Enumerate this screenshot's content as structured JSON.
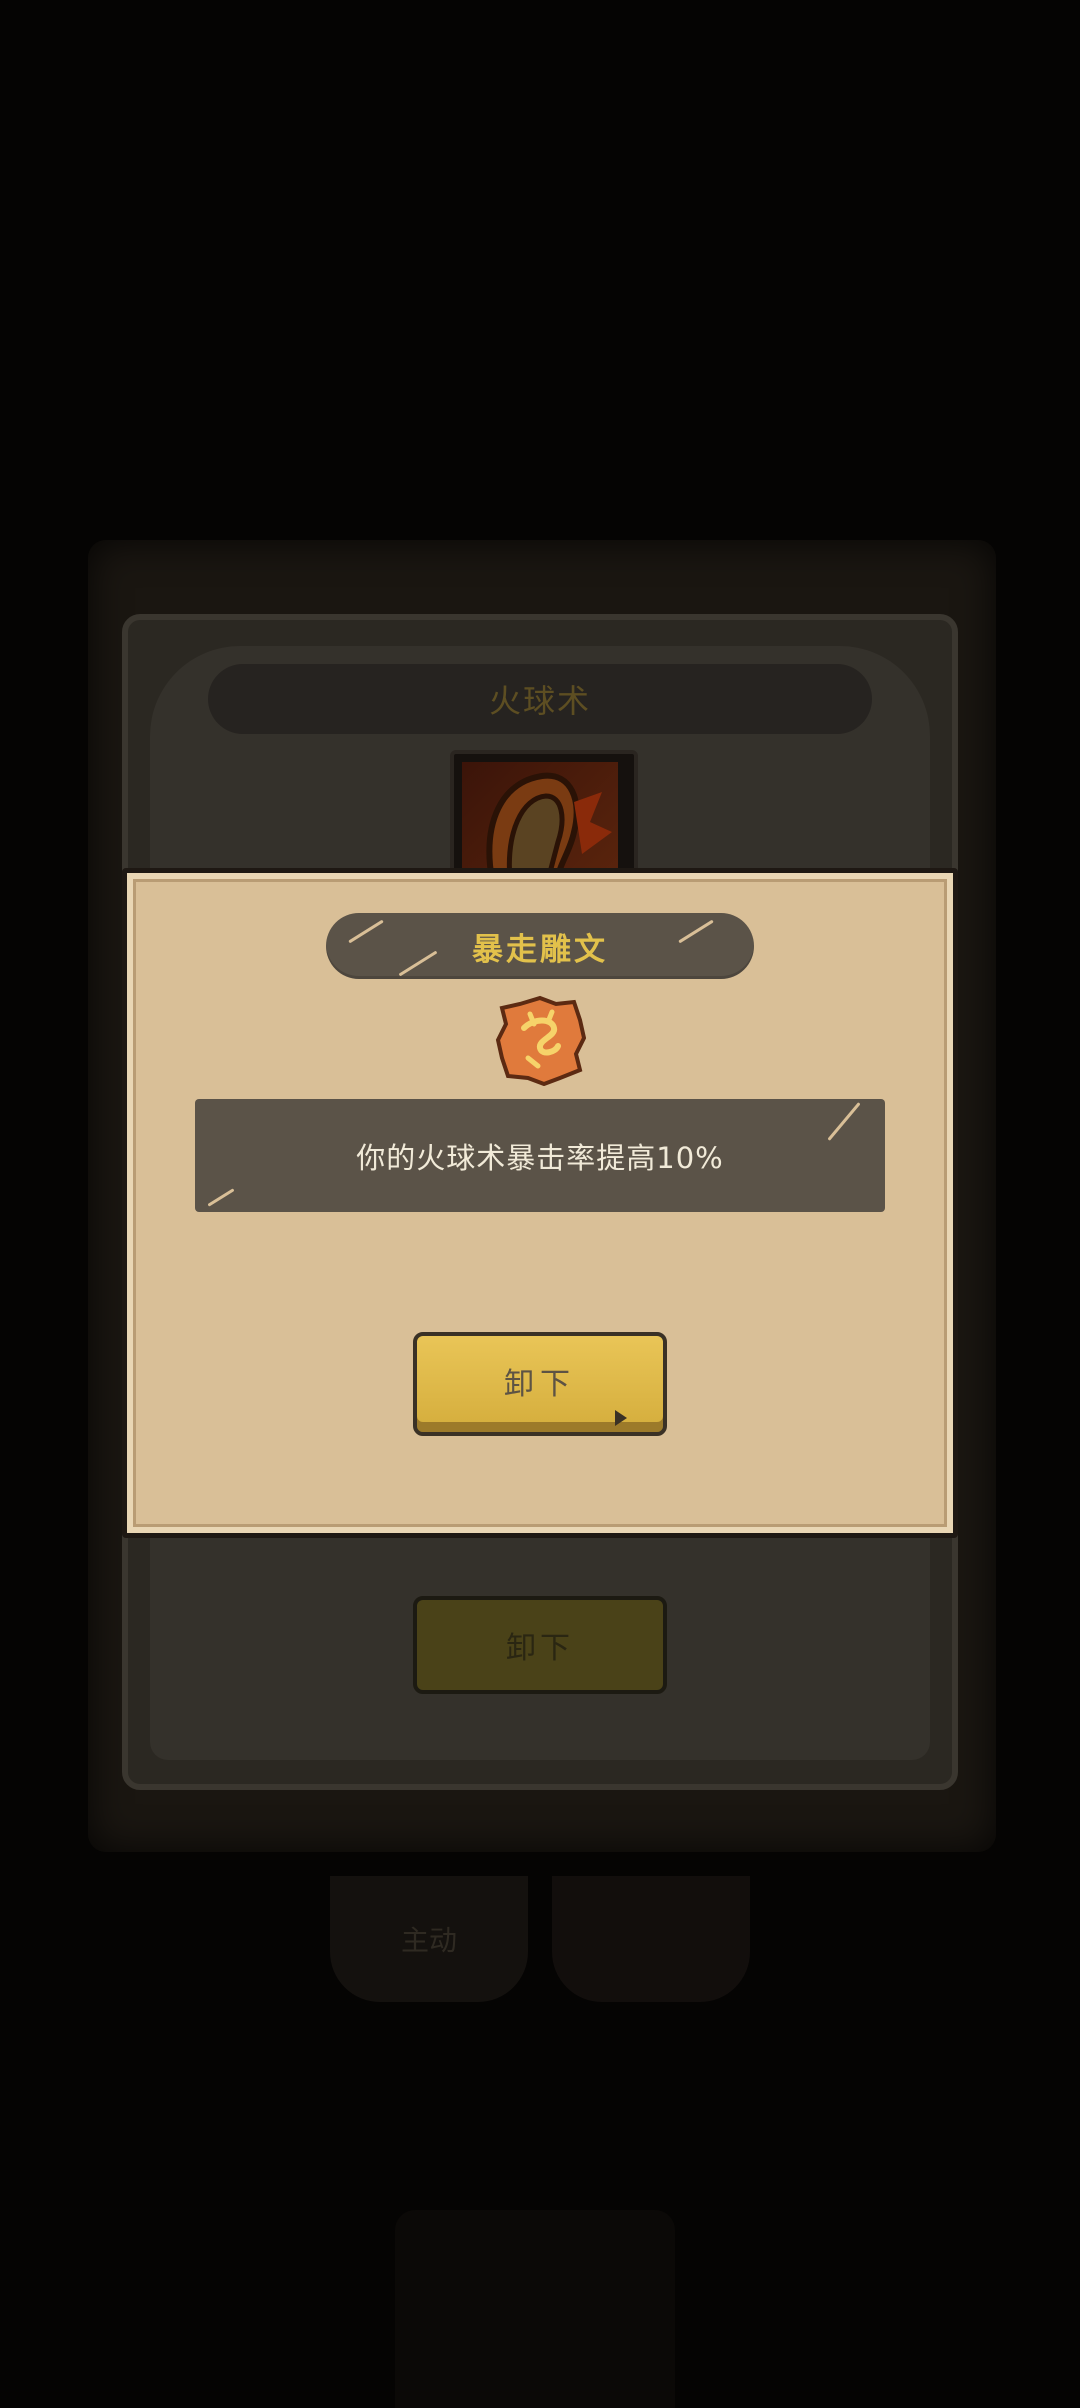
{
  "background_panel": {
    "title": "火球术",
    "unequip_label": "卸下",
    "tab_label": "主动"
  },
  "dialog": {
    "title": "暴走雕文",
    "rune_icon": "fire-rune-icon",
    "description": "你的火球术暴击率提高10%",
    "unequip_label": "卸下"
  },
  "colors": {
    "parchment": "#d9bf97",
    "banner": "#5b5348",
    "title_gold": "#e2c14b",
    "button_gold": "#e0bb4c",
    "rune_orange": "#e07a3c"
  }
}
